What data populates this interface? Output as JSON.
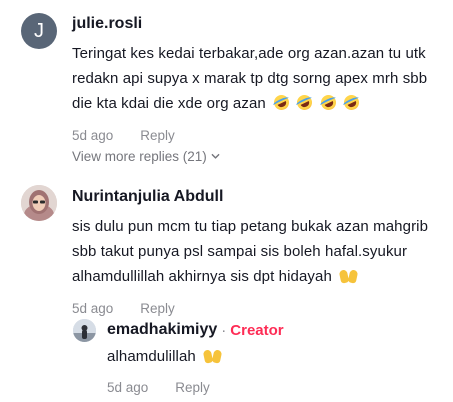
{
  "comments": [
    {
      "avatar_letter": "J",
      "username": "julie.rosli",
      "lines": [
        "Teringat kes kedai terbakar,ade org azan.azan tu utk",
        "redakn api supya x marak tp dtg sorng apex mrh sbb",
        "die kta kdai die xde org azan"
      ],
      "time": "5d ago",
      "reply_label": "Reply",
      "view_more": "View more replies (21)"
    },
    {
      "username": "Nurintanjulia Abdull",
      "lines": [
        "sis dulu pun mcm tu tiap petang bukak azan mahgrib",
        "sbb takut punya psl sampai sis boleh hafal.syukur",
        "alhamdullillah akhirnya sis dpt hidayah"
      ],
      "time": "5d ago",
      "reply_label": "Reply"
    }
  ],
  "reply": {
    "username": "emadhakimiyy",
    "separator": "·",
    "badge": "Creator",
    "text": "alhamdulillah",
    "time": "5d ago",
    "reply_label": "Reply"
  },
  "colors": {
    "accent": "#fe2c55",
    "muted": "#8a8b91",
    "text": "#161823"
  },
  "icons": {
    "laugh_emoji": "rolling-on-floor-laughing",
    "hands_emoji": "raised-hands",
    "chevron": "chevron-down"
  }
}
